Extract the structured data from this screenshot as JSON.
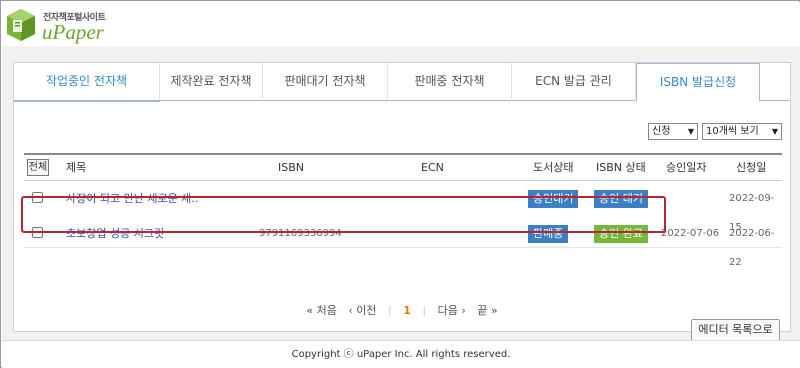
{
  "header": {
    "logo_sub": "전자책포털사이트",
    "logo_main": "uPaper"
  },
  "tabs": [
    {
      "label": "작업중인 전자책"
    },
    {
      "label": "제작완료 전자책"
    },
    {
      "label": "판매대기 전자책"
    },
    {
      "label": "판매중 전자책"
    },
    {
      "label": "ECN 발급 관리"
    },
    {
      "label": "ISBN 발급신청"
    }
  ],
  "filters": {
    "sort_value": "신청",
    "count_value": "10개씩 보기"
  },
  "table": {
    "headers": {
      "all": "전체",
      "title": "제목",
      "isbn": "ISBN",
      "ecn": "ECN",
      "book_status": "도서상태",
      "isbn_status": "ISBN 상태",
      "approved": "승인일자",
      "requested": "신청일"
    },
    "rows": [
      {
        "title": "사장이 되고 만난 새로운 세..",
        "isbn": "",
        "ecn": "",
        "book_status": "승인대기",
        "isbn_status": "승인 대기",
        "approved": "",
        "requested": "2022-09-15"
      },
      {
        "title": "초보창업 성공 시크릿",
        "isbn": "9791169336994",
        "ecn": "",
        "book_status": "판매중",
        "isbn_status": "승인 완료",
        "approved": "2022-07-06",
        "requested": "2022-06-22"
      }
    ]
  },
  "pager": {
    "first": "« 처음",
    "prev": "‹ 이전",
    "current": "1",
    "next": "다음 ›",
    "last": "끝 »"
  },
  "editor_button": "에디터 목록으로",
  "footer": "Copyright ⓒ uPaper Inc. All rights reserved.",
  "colors": {
    "accent_blue": "#3b7fc4",
    "accent_green": "#74b83a",
    "highlight_red": "#b9252e",
    "pager_current": "#e07b12"
  }
}
